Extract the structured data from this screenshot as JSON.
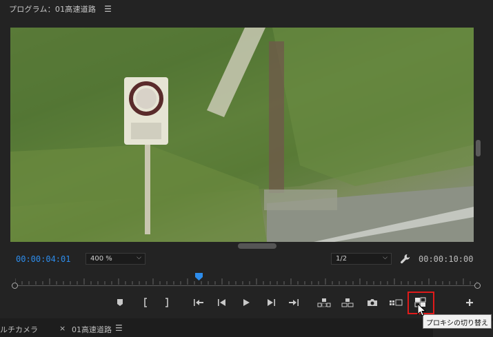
{
  "program_panel": {
    "title": "プログラム：01高速道路",
    "menu_icon": "hamburger-icon"
  },
  "monitor": {
    "current_timecode": "00:00:04:01",
    "duration_timecode": "00:00:10:00",
    "zoom_label": "400 %",
    "resolution_label": "1/2",
    "playhead_position_fraction": 0.4
  },
  "controls": [
    {
      "name": "add-marker-button",
      "icon": "marker-icon"
    },
    {
      "name": "mark-in-button",
      "icon": "mark-in-icon"
    },
    {
      "name": "mark-out-button",
      "icon": "mark-out-icon"
    },
    {
      "name": "go-to-in-button",
      "icon": "go-to-in-icon"
    },
    {
      "name": "step-back-button",
      "icon": "step-back-icon"
    },
    {
      "name": "play-button",
      "icon": "play-icon"
    },
    {
      "name": "step-forward-button",
      "icon": "step-forward-icon"
    },
    {
      "name": "go-to-out-button",
      "icon": "go-to-out-icon"
    },
    {
      "name": "lift-button",
      "icon": "lift-icon"
    },
    {
      "name": "extract-button",
      "icon": "extract-icon"
    },
    {
      "name": "export-frame-button",
      "icon": "camera-icon"
    },
    {
      "name": "comparison-view-button",
      "icon": "comparison-view-icon"
    },
    {
      "name": "toggle-proxies-button",
      "icon": "proxy-icon"
    },
    {
      "name": "button-editor-button",
      "icon": "plus-icon"
    }
  ],
  "tooltip": {
    "text": "プロキシの切り替え"
  },
  "bottom_tabs": {
    "tab1": "ルチカメラ",
    "close": "×",
    "tab2": "01高速道路"
  },
  "colors": {
    "timecode_accent": "#2d8ceb",
    "highlight_box": "#e11a1a"
  }
}
